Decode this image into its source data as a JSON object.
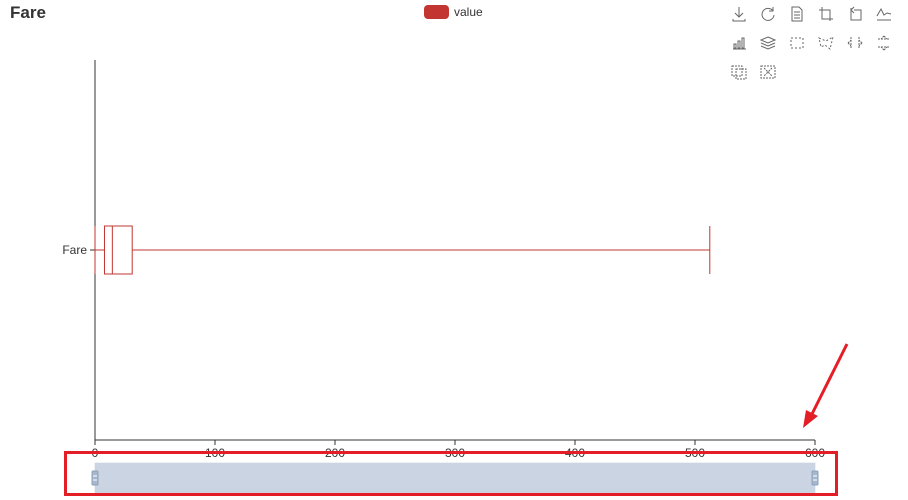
{
  "title": "Fare",
  "legend": {
    "label": "value",
    "color": "#c23531"
  },
  "toolbox": [
    {
      "name": "save-as-image-icon",
      "tooltip": ""
    },
    {
      "name": "restore-icon",
      "tooltip": ""
    },
    {
      "name": "data-view-icon",
      "tooltip": ""
    },
    {
      "name": "zoom-icon",
      "tooltip": ""
    },
    {
      "name": "zoom-back-icon",
      "tooltip": ""
    },
    {
      "name": "line-chart-icon",
      "tooltip": ""
    },
    {
      "name": "bar-chart-icon",
      "tooltip": ""
    },
    {
      "name": "stack-icon",
      "tooltip": ""
    },
    {
      "name": "brush-rect-icon",
      "tooltip": ""
    },
    {
      "name": "brush-polygon-icon",
      "tooltip": ""
    },
    {
      "name": "brush-line-x-icon",
      "tooltip": ""
    },
    {
      "name": "brush-line-y-icon",
      "tooltip": ""
    },
    {
      "name": "brush-keep-icon",
      "tooltip": ""
    },
    {
      "name": "brush-clear-icon",
      "tooltip": ""
    }
  ],
  "chart_data": {
    "type": "boxplot",
    "orientation": "horizontal",
    "categories": [
      "Fare"
    ],
    "series": [
      {
        "name": "value",
        "color": "#c23531",
        "values": [
          [
            0,
            7.9,
            14.45,
            31,
            512.33
          ]
        ]
      }
    ],
    "xaxis": {
      "min": 0,
      "max": 600,
      "ticks": [
        0,
        100,
        200,
        300,
        400,
        500,
        600
      ],
      "tick_labels": [
        "0",
        "100",
        "200",
        "300",
        "400",
        "500",
        "600"
      ]
    },
    "datazoom": {
      "start": 0,
      "end": 100
    },
    "grid": false
  }
}
